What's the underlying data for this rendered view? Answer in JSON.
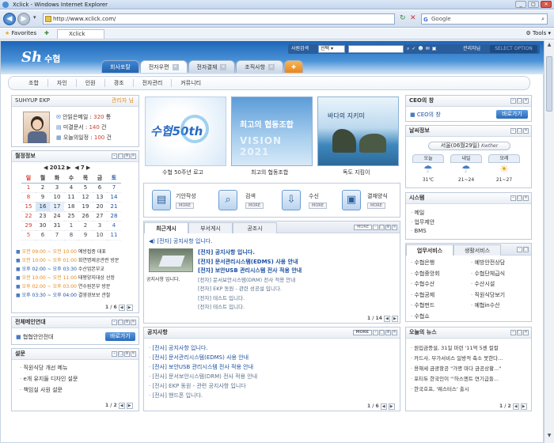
{
  "browser": {
    "title": "Xclick - Windows Internet Explorer",
    "url": "http://www.xclick.com/",
    "search_placeholder": "Google",
    "favorites_label": "Favorites",
    "tab_label": "Xclick",
    "tools_label": "Tools"
  },
  "site": {
    "logo": "Sh",
    "logo_sub": "수협",
    "search_label": "사원검색",
    "search_select": "선택",
    "user_label": "관리자님",
    "option_label": "SELECT OPTION",
    "main_tabs": [
      "회사포탈",
      "전자우편",
      "전자결재",
      "조직사항"
    ],
    "subnav": [
      "조합",
      "자인",
      "인원",
      "경조",
      "전자관리",
      "커뮤니티"
    ]
  },
  "profile": {
    "title": "SUHYUP EKP",
    "role": "관리자 님",
    "stats": [
      {
        "label": "안읽은메일 : ",
        "value": "320",
        "unit": " 통"
      },
      {
        "label": "미결문서 : ",
        "value": "140",
        "unit": " 건"
      },
      {
        "label": "오늘의일정 : ",
        "value": "100",
        "unit": " 건"
      }
    ]
  },
  "schedule": {
    "title": "월정정보",
    "year": "2012",
    "month": "7",
    "days": [
      "일",
      "월",
      "화",
      "수",
      "목",
      "금",
      "토"
    ],
    "weeks": [
      [
        "1",
        "2",
        "3",
        "4",
        "5",
        "6",
        "7"
      ],
      [
        "8",
        "9",
        "10",
        "11",
        "12",
        "13",
        "14"
      ],
      [
        "15",
        "16",
        "17",
        "18",
        "19",
        "20",
        "21"
      ],
      [
        "22",
        "23",
        "24",
        "25",
        "26",
        "27",
        "28"
      ],
      [
        "29",
        "30",
        "31",
        "1",
        "2",
        "3",
        "4"
      ],
      [
        "5",
        "6",
        "7",
        "8",
        "9",
        "10",
        "11"
      ]
    ],
    "events": [
      {
        "time": "오전 09:00 ~ 오전 10:00",
        "title": "예방접종 대표"
      },
      {
        "time": "오전 10:00 ~ 오후 01:00",
        "title": "회연명제공관련 방문"
      },
      {
        "time": "오후 02:00 ~ 오후 03:30",
        "title": "수산업본부교"
      },
      {
        "time": "오전 10:00 ~ 오전 11:00",
        "title": "태평양지대상 선정"
      },
      {
        "time": "오후 02:00 ~ 오후 03:00",
        "title": "연수원본부 방문"
      },
      {
        "time": "오후 03:30 ~ 오후 04:00",
        "title": "결영경보보 관찰"
      }
    ],
    "page": "1 / 6"
  },
  "notice_left": {
    "title": "전체메인연대",
    "item": "협협안안전대",
    "button": "바로가기"
  },
  "survey": {
    "title": "설문",
    "items": [
      "직원식당 개선 메뉴",
      "e개 유지들 디자인 설문",
      "책임실 사원 설문"
    ],
    "page": "1 / 2"
  },
  "banners": [
    {
      "caption": "수협 50주년 로고",
      "text": "수협50th"
    },
    {
      "caption": "최고의 협동조합",
      "text": "최고의 협동조합"
    },
    {
      "caption": "독도 지킴이",
      "text": "바다의 지키미"
    }
  ],
  "quick": [
    {
      "label": "기안작성",
      "more": "MORE"
    },
    {
      "label": "검색",
      "more": "MORE"
    },
    {
      "label": "수신",
      "more": "MORE"
    },
    {
      "label": "결재양식",
      "more": "MORE"
    }
  ],
  "board": {
    "tabs": [
      "최근게시",
      "부서게시",
      "공조시"
    ],
    "more": "MORE",
    "head": "[전자] 공지사항 입니다.",
    "thumb_label": "공지사항 입니다.",
    "items": [
      "[전자] 공지사항 입니다.",
      "[전자] 문서관리시스템(EDMS) 사용 안내",
      "[전자] 보안USB 관리시스템 전사 적용 안내",
      "[전자] 문서보안시스템(DRM) 전사 적용 안내",
      "[전자] EKP 동원 - 관련 성공설 입니다.",
      "[전자] 테스트 입니다.",
      "[전자] 테스트 입니다."
    ],
    "page": "1 / 14"
  },
  "notice": {
    "title": "공지사항",
    "more": "MORE",
    "items": [
      "[전사] 공지사항 입니다.",
      "[전사] 문서관리시스템(EDMS) 사용 안내",
      "[전사] 보안USB 관리시스템 전사 적용 안내",
      "[전사] 문서보안시스템(DRM) 전사 적용 안내",
      "[전사] EKP 동원 - 관련 공지사항 입니다",
      "[전사] 핸드폰 입니다."
    ],
    "page": "1 / 6"
  },
  "ceo": {
    "title": "CEO의 창",
    "item": "CEO의 창",
    "button": "바로가기"
  },
  "weather": {
    "title": "날씨정보",
    "city": "서울(06월29일)",
    "brand": "Kwther",
    "days": [
      {
        "day": "오늘",
        "temp": "31℃",
        "icon": "rain-icon"
      },
      {
        "day": "내일",
        "temp": "21~24",
        "icon": "rain-icon"
      },
      {
        "day": "모레",
        "temp": "21~27",
        "icon": "sun-cloud-icon"
      }
    ]
  },
  "system": {
    "title": "시스템",
    "items": [
      "메일",
      "업무제안",
      "BMS"
    ]
  },
  "services": {
    "tabs": [
      "업무서비스",
      "생활서비스"
    ],
    "col1": [
      "수협은행",
      "수협중앙회",
      "수협수산",
      "수협공제",
      "수협펀드",
      "수협쇼"
    ],
    "col2": [
      "예방안전상담",
      "수협단체급식",
      "수산시설",
      "직원식당보기",
      "예협in수산"
    ]
  },
  "news": {
    "title": "오늘의 뉴스",
    "items": [
      "원입금증설, 31일 마련 '11억 5센 컬컬",
      "카드사, 부가서비스 일방적 축소 못한다...",
      "용해세 금광항공 \"가명 마다 금공상황...\"",
      "포티듀 한국인이 \"'하스엔트 연기급들...",
      "한국호프, '웨스터스' 출시"
    ],
    "page": "1 / 2"
  }
}
